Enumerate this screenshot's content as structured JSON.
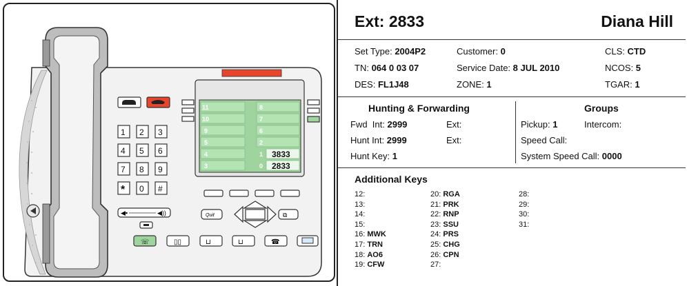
{
  "header": {
    "ext_label": "Ext:",
    "ext_value": "2833",
    "name": "Diana Hill"
  },
  "details": {
    "set_type_label": "Set Type:",
    "set_type": "2004P2",
    "customer_label": "Customer:",
    "customer": "0",
    "cls_label": "CLS:",
    "cls": "CTD",
    "tn_label": "TN:",
    "tn": "064 0 03 07",
    "service_date_label": "Service Date:",
    "service_date": "8 JUL 2010",
    "ncos_label": "NCOS:",
    "ncos": "5",
    "des_label": "DES:",
    "des": "FL1J48",
    "zone_label": "ZONE:",
    "zone": "1",
    "tgar_label": "TGAR:",
    "tgar": "1"
  },
  "hunting": {
    "title": "Hunting & Forwarding",
    "fwd_int_label": "Fwd  Int:",
    "fwd_int": "2999",
    "fwd_ext_label": "Ext:",
    "hunt_int_label": "Hunt Int:",
    "hunt_int": "2999",
    "hunt_ext_label": "Ext:",
    "hunt_key_label": "Hunt Key:",
    "hunt_key": "1"
  },
  "groups": {
    "title": "Groups",
    "pickup_label": "Pickup:",
    "pickup": "1",
    "intercom_label": "Intercom:",
    "speed_call_label": "Speed Call:",
    "system_speed_call_label": "System Speed Call:",
    "system_speed_call": "0000"
  },
  "additional_keys": {
    "title": "Additional Keys",
    "col1": [
      {
        "num": "12:",
        "val": ""
      },
      {
        "num": "13:",
        "val": ""
      },
      {
        "num": "14:",
        "val": ""
      },
      {
        "num": "15:",
        "val": ""
      },
      {
        "num": "16:",
        "val": "MWK"
      },
      {
        "num": "17:",
        "val": "TRN"
      },
      {
        "num": "18:",
        "val": "AO6"
      },
      {
        "num": "19:",
        "val": "CFW"
      }
    ],
    "col2": [
      {
        "num": "20:",
        "val": "RGA"
      },
      {
        "num": "21:",
        "val": "PRK"
      },
      {
        "num": "22:",
        "val": "RNP"
      },
      {
        "num": "23:",
        "val": "SSU"
      },
      {
        "num": "24:",
        "val": "PRS"
      },
      {
        "num": "25:",
        "val": "CHG"
      },
      {
        "num": "26:",
        "val": "CPN"
      },
      {
        "num": "27:",
        "val": ""
      }
    ],
    "col3": [
      {
        "num": "28:",
        "val": ""
      },
      {
        "num": "29:",
        "val": ""
      },
      {
        "num": "30:",
        "val": ""
      },
      {
        "num": "31:",
        "val": ""
      }
    ]
  },
  "phone": {
    "dialpad": [
      "1",
      "2",
      "3",
      "4",
      "5",
      "6",
      "7",
      "8",
      "9",
      "*",
      "0",
      "#"
    ],
    "lcd_left": [
      "11",
      "10",
      "9",
      "5",
      "4",
      "3"
    ],
    "lcd_right": [
      "8",
      "7",
      "6",
      "2",
      "1",
      "0"
    ],
    "lcd_ext_1": "3833",
    "lcd_ext_0": "2833",
    "quit_label": "Quit",
    "colors": {
      "lcd": "#9fd49f",
      "lcd_cell": "#b4e3b4",
      "body": "#f2f2f2",
      "handset": "#bdbdbd",
      "red_bar": "#e8452c",
      "release": "#e8452c"
    }
  }
}
